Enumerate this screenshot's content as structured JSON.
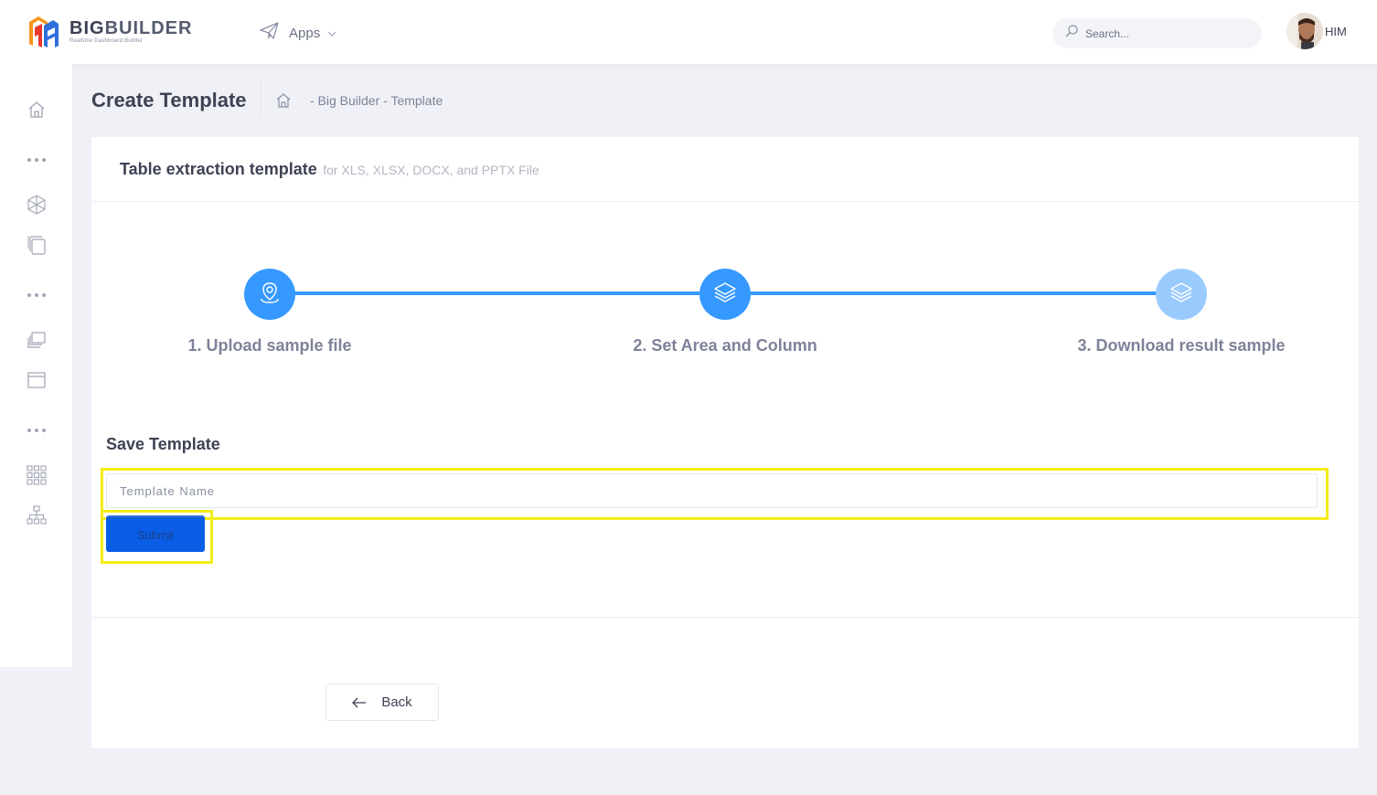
{
  "brand": {
    "name_part1": "BIG",
    "name_part2": "BUILDER",
    "tagline": "Realtime Dashboard Builder",
    "colors": {
      "orange": "#f7941d",
      "red": "#e8382e",
      "blue": "#2f6fdc"
    }
  },
  "header": {
    "apps_label": "Apps",
    "search_placeholder": "Search...",
    "user_name": "HIM"
  },
  "sidebar": {
    "items": [
      {
        "icon": "home-icon"
      },
      {
        "icon": "dots-icon"
      },
      {
        "icon": "hexagon-icon"
      },
      {
        "icon": "files-icon"
      },
      {
        "icon": "dots-icon"
      },
      {
        "icon": "layers-stack-icon"
      },
      {
        "icon": "window-icon"
      },
      {
        "icon": "dots-icon"
      },
      {
        "icon": "grid-icon"
      },
      {
        "icon": "sitemap-icon"
      }
    ]
  },
  "subheader": {
    "title": "Create Template",
    "breadcrumb": "- Big Builder - Template"
  },
  "card": {
    "title": "Table extraction template",
    "subtitle": "for XLS, XLSX, DOCX, and PPTX File"
  },
  "wizard": {
    "steps": [
      {
        "label": "1. Upload sample file",
        "icon": "map-pin-icon",
        "state": "done"
      },
      {
        "label": "2. Set Area and Column",
        "icon": "layers-icon",
        "state": "current"
      },
      {
        "label": "3. Download result sample",
        "icon": "layers-icon",
        "state": "pending"
      }
    ],
    "colors": {
      "active": "#3699ff",
      "pending": "#99cbff"
    }
  },
  "form": {
    "section_title": "Save Template",
    "name_placeholder": "Template Name",
    "name_value": "",
    "submit_label": "Submit",
    "back_label": "Back"
  },
  "highlight_color": "#f4ec16"
}
